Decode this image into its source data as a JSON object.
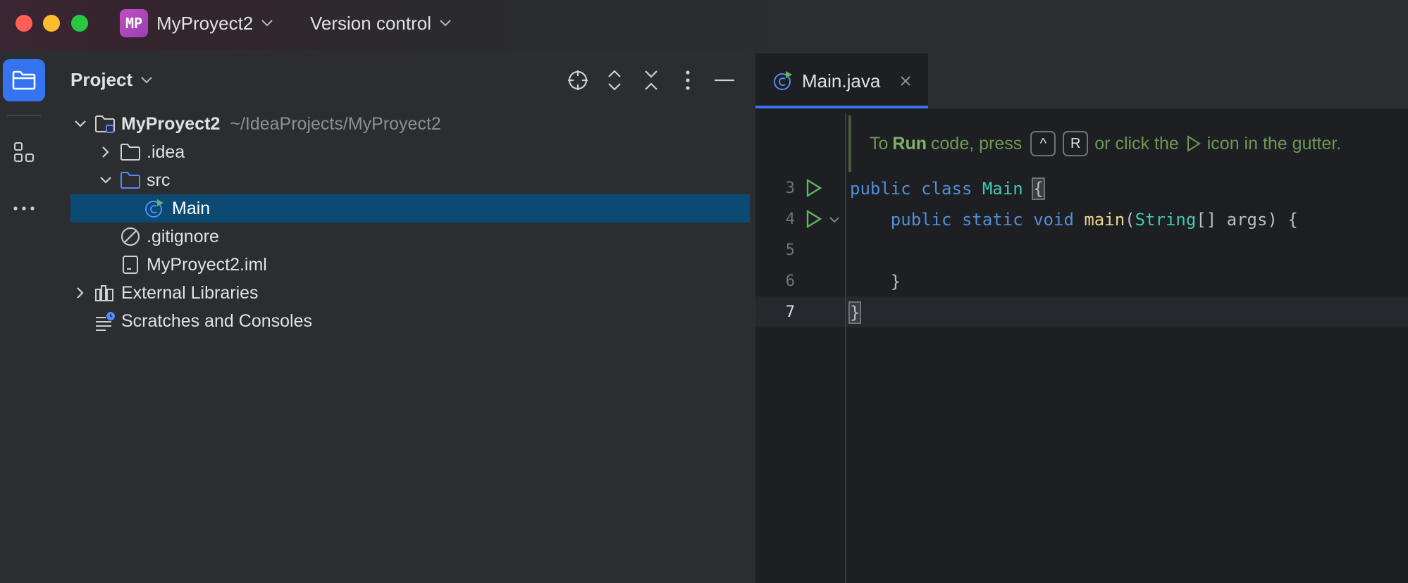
{
  "titlebar": {
    "project_badge": "MP",
    "project_name": "MyProyect2",
    "vcs_label": "Version control"
  },
  "toolstrip": {
    "items": [
      "project-icon",
      "structure-icon",
      "more-icon"
    ]
  },
  "project_panel": {
    "title": "Project",
    "tools": [
      "locate-icon",
      "expand-all-icon",
      "collapse-all-icon",
      "options-icon",
      "hide-icon"
    ],
    "tree": [
      {
        "label": "MyProyect2",
        "path": "~/IdeaProjects/MyProyect2",
        "expanded": true,
        "icon": "module-folder-icon"
      },
      {
        "label": ".idea",
        "expanded": false,
        "icon": "folder-icon"
      },
      {
        "label": "src",
        "expanded": true,
        "icon": "source-folder-icon"
      },
      {
        "label": "Main",
        "selected": true,
        "icon": "java-class-icon"
      },
      {
        "label": ".gitignore",
        "icon": "ignore-file-icon"
      },
      {
        "label": "MyProyect2.iml",
        "icon": "iml-file-icon"
      },
      {
        "label": "External Libraries",
        "expanded": false,
        "icon": "libraries-icon"
      },
      {
        "label": "Scratches and Consoles",
        "icon": "scratches-icon"
      }
    ]
  },
  "editor": {
    "tab_label": "Main.java",
    "hint": {
      "prefix": "To",
      "run_word": "Run",
      "middle": "code, press",
      "key1": "^",
      "key2": "R",
      "suffix1": "or click the",
      "suffix2": "icon in the gutter."
    },
    "lines": [
      {
        "no": "3",
        "text": "public class Main {"
      },
      {
        "no": "4",
        "text": "    public static void main(String[] args) {"
      },
      {
        "no": "5",
        "text": ""
      },
      {
        "no": "6",
        "text": "    }"
      },
      {
        "no": "7",
        "text": "}"
      }
    ],
    "code": {
      "l3_public": "public",
      "l3_class": "class",
      "l3_name": "Main",
      "l3_brace": "{",
      "l4_indent": "    ",
      "l4_public": "public",
      "l4_static": "static",
      "l4_void": "void",
      "l4_main": "main",
      "l4_paren": "(",
      "l4_type": "String",
      "l4_args": "[] args) {",
      "l6": "    }",
      "l7": "}"
    }
  },
  "colors": {
    "accent": "#3574f0",
    "selection": "#0c4a73",
    "keyword": "#4f8fd6",
    "class": "#3ec9b0",
    "method": "#e8d78f",
    "hint": "#6a9955"
  }
}
